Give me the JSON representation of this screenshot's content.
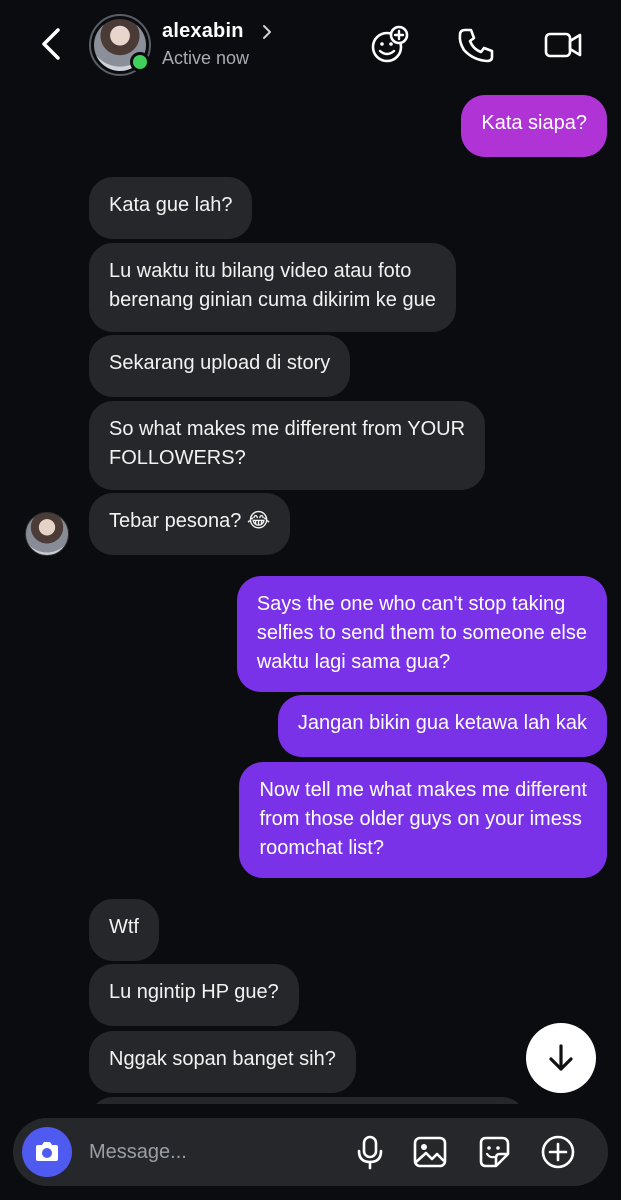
{
  "header": {
    "username": "alexabin",
    "status": "Active now",
    "icons": [
      "back-arrow-icon",
      "chevron-right-icon",
      "effects-icon",
      "phone-icon",
      "video-camera-icon"
    ]
  },
  "messages": [
    {
      "side": "sent",
      "color": "#b033d6",
      "text": "Kata siapa?"
    },
    {
      "side": "received",
      "text": "Kata gue lah?"
    },
    {
      "side": "received",
      "text": "Lu waktu itu bilang video atau foto",
      "text2": "berenang ginian cuma dikirim ke gue"
    },
    {
      "side": "received",
      "text": "Sekarang upload di story"
    },
    {
      "side": "received",
      "text": "So what makes me different from YOUR",
      "text2": "FOLLOWERS?"
    },
    {
      "side": "received",
      "text": "Tebar pesona? 😂"
    },
    {
      "side": "sent",
      "color": "#7a32e8",
      "text": "Says the one who can't stop taking",
      "text2": "selfies to send them to someone else",
      "text3": "waktu lagi sama gua?"
    },
    {
      "side": "sent",
      "color": "#7a32e8",
      "text": "Jangan bikin gua ketawa lah kak"
    },
    {
      "side": "sent",
      "color": "#7a32e8",
      "text": "Now tell me what makes me different",
      "text2": "from those older guys on your imess",
      "text3": "roomchat list?"
    },
    {
      "side": "received",
      "text": "Wtf"
    },
    {
      "side": "received",
      "text": "Lu ngintip HP gue?"
    },
    {
      "side": "received",
      "text": "Nggak sopan banget sih?"
    }
  ],
  "composer": {
    "placeholder": "Message...",
    "icons": [
      "camera-icon",
      "microphone-icon",
      "gallery-icon",
      "sticker-icon",
      "add-icon"
    ]
  },
  "colors": {
    "background": "#0b0c0f",
    "received_bubble": "#26272b",
    "sent_pink": "#b033d6",
    "sent_purple": "#7a32e8",
    "online": "#3fd15b",
    "camera_button": "#4f5bf0"
  }
}
